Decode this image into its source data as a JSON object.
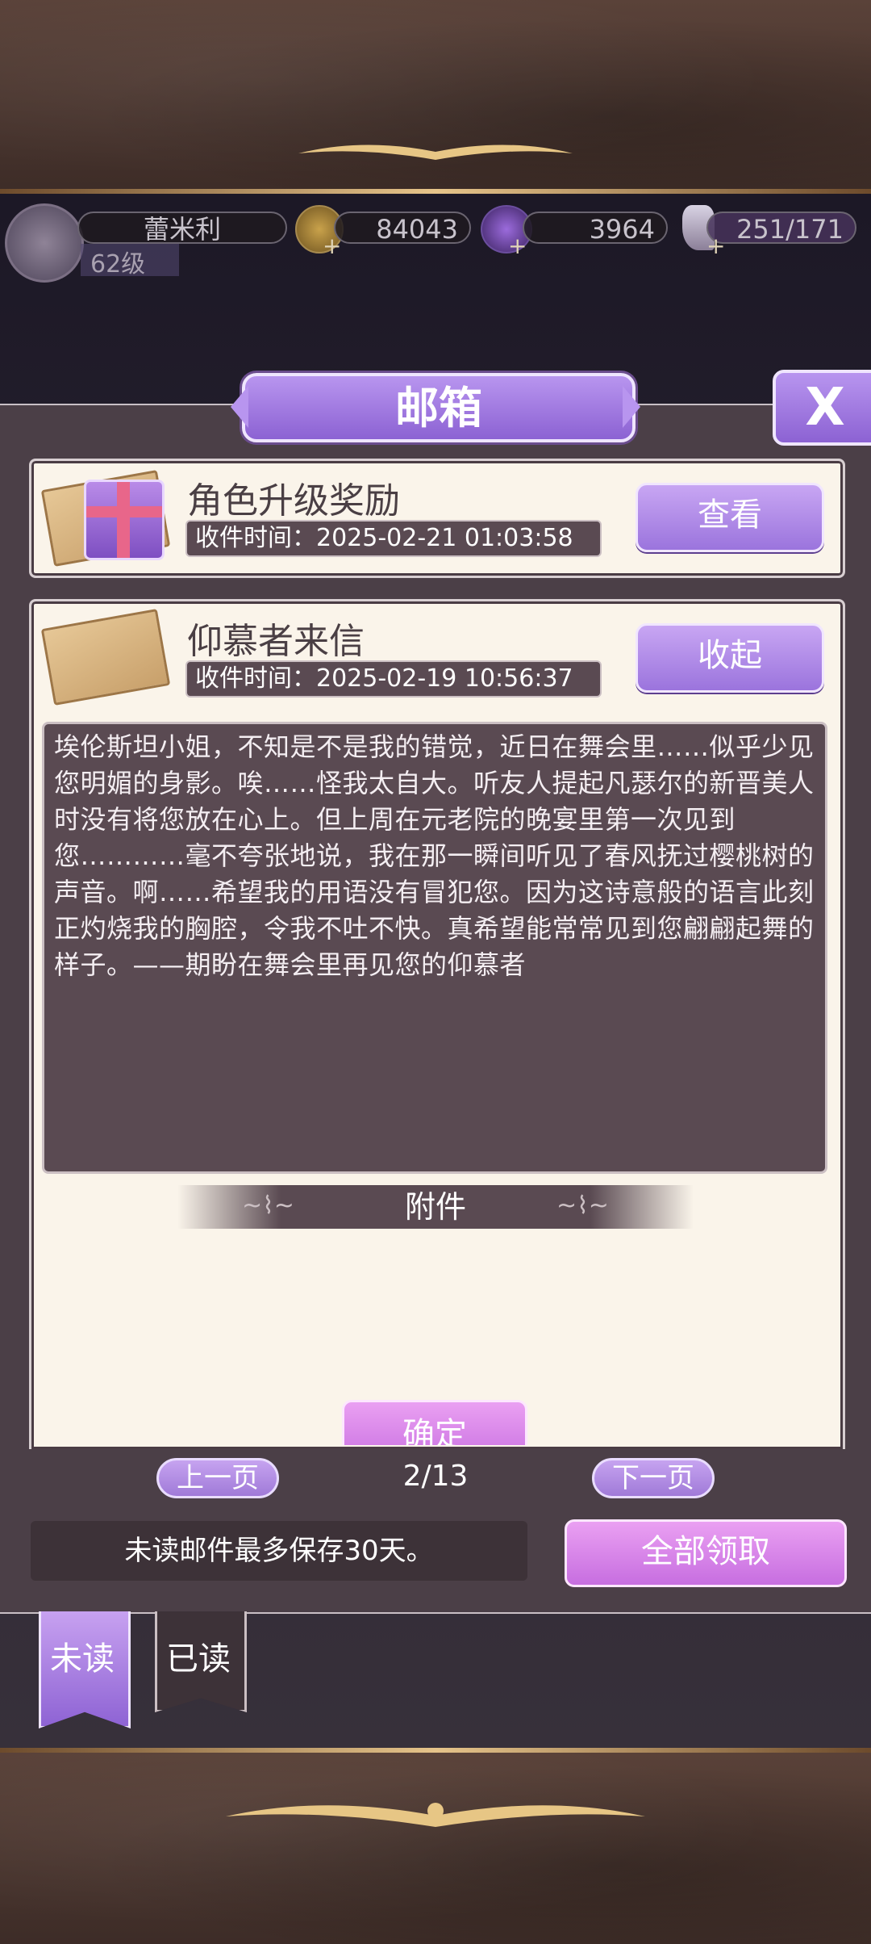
{
  "hud": {
    "player_name": "蕾米利",
    "level": "62级",
    "gold": "84043",
    "gems": "3964",
    "stamina": "251/171"
  },
  "mailbox": {
    "title": "邮箱",
    "close": "X",
    "mails": [
      {
        "title": "角色升级奖励",
        "time": "收件时间：2025-02-21 01:03:58",
        "button": "查看"
      },
      {
        "title": "仰慕者来信",
        "time": "收件时间：2025-02-19 10:56:37",
        "button": "收起",
        "body": "埃伦斯坦小姐，不知是不是我的错觉，近日在舞会里……似乎少见您明媚的身影。唉……怪我太自大。听友人提起凡瑟尔的新晋美人时没有将您放在心上。但上周在元老院的晚宴里第一次见到您…………毫不夸张地说，我在那一瞬间听见了春风抚过樱桃树的声音。啊……希望我的用语没有冒犯您。因为这诗意般的语言此刻正灼烧我的胸腔，令我不吐不快。真希望能常常见到您翩翩起舞的样子。——期盼在舞会里再见您的仰慕者",
        "attachment_label": "附件",
        "confirm": "确定"
      }
    ],
    "pager": {
      "prev": "上一页",
      "page": "2/13",
      "next": "下一页"
    },
    "notice": "未读邮件最多保存30天。",
    "claim_all": "全部领取",
    "tabs": {
      "unread": "未读",
      "read": "已读"
    }
  },
  "colors": {
    "accent_purple": "#9b74dd",
    "accent_pink": "#c76ee0",
    "card_bg": "#faf4ea",
    "panel_bg": "#4b3f47"
  }
}
